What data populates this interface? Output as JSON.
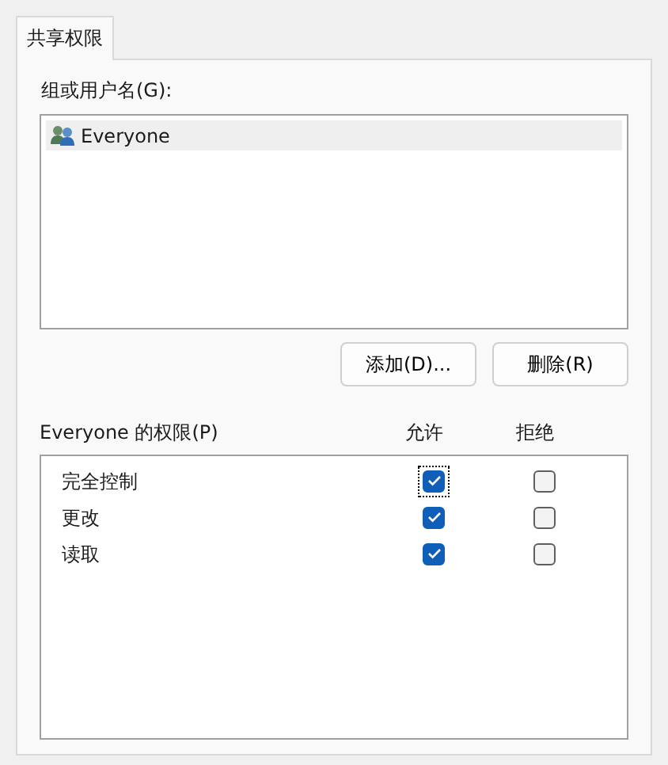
{
  "tabs": [
    {
      "label": "共享权限",
      "selected": true
    }
  ],
  "groups": {
    "label": "组或用户名(G):",
    "items": [
      {
        "name": "Everyone",
        "selected": true
      }
    ]
  },
  "buttons": [
    "添加(D)...",
    "删除(R)"
  ],
  "permissions": {
    "label": "Everyone 的权限(P)",
    "columns": [
      "允许",
      "拒绝"
    ],
    "rows": [
      {
        "name": "完全控制",
        "allow": true,
        "deny": false,
        "focused": true
      },
      {
        "name": "更改",
        "allow": true,
        "deny": false,
        "focused": false
      },
      {
        "name": "读取",
        "allow": true,
        "deny": false,
        "focused": false
      }
    ]
  }
}
